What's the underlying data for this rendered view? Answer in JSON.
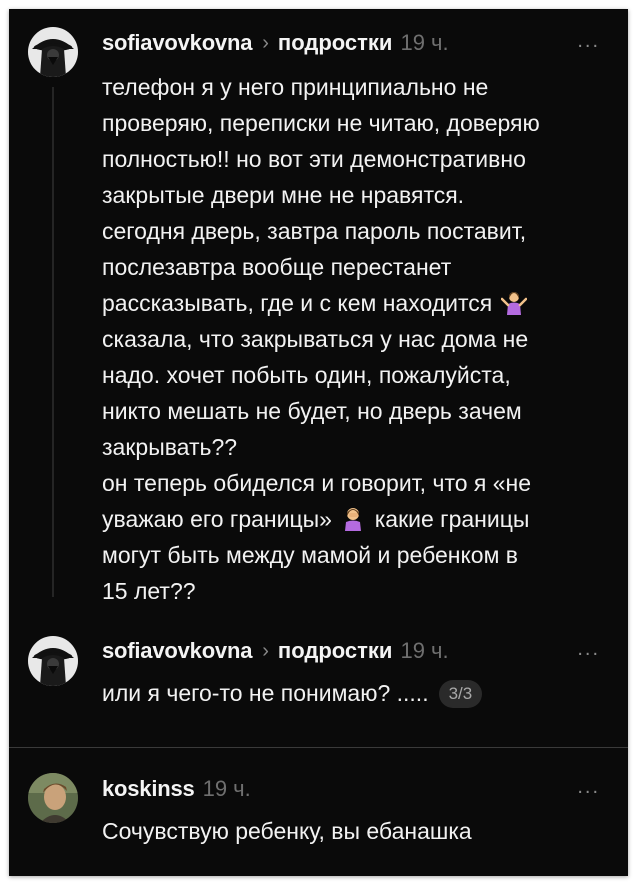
{
  "comments": [
    {
      "username": "sofiavovkovna",
      "chevron": "›",
      "group": "подростки",
      "time": "19 ч.",
      "more": "...",
      "lines": [
        "телефон я у него принципиально не",
        "проверяю, переписки не читаю, доверяю",
        "полностью!! но вот эти демонстративно",
        "закрытые двери мне не нравятся.",
        "сегодня дверь, завтра пароль поставит,",
        "послезавтра вообще перестанет",
        "рассказывать, где и с кем находится",
        "сказала, что закрываться у нас дома не",
        "надо. хочет побыть один, пожалуйста,",
        "никто мешать не будет, но дверь зачем",
        "закрывать??",
        "он теперь обиделся и говорит, что я «не",
        "уважаю его границы»",
        "какие границы",
        "могут быть между мамой и ребенком в",
        "15 лет??"
      ]
    },
    {
      "username": "sofiavovkovna",
      "chevron": "›",
      "group": "подростки",
      "time": "19 ч.",
      "more": "...",
      "text": "или я чего-то не понимаю? .....",
      "badge": "3/3"
    },
    {
      "username": "koskinss",
      "time": "19 ч.",
      "more": "...",
      "text": "Сочувствую ребенку, вы ебанашка"
    }
  ],
  "icons": {
    "shrug": "person-shrugging-emoji",
    "facepalm": "person-facepalming-emoji",
    "avatar1": "hooded-figure-avatar",
    "avatar3": "man-portrait-avatar"
  },
  "colors": {
    "background": "#0a0a0a",
    "text": "#f2f2f2",
    "muted": "#6f6f6f"
  }
}
